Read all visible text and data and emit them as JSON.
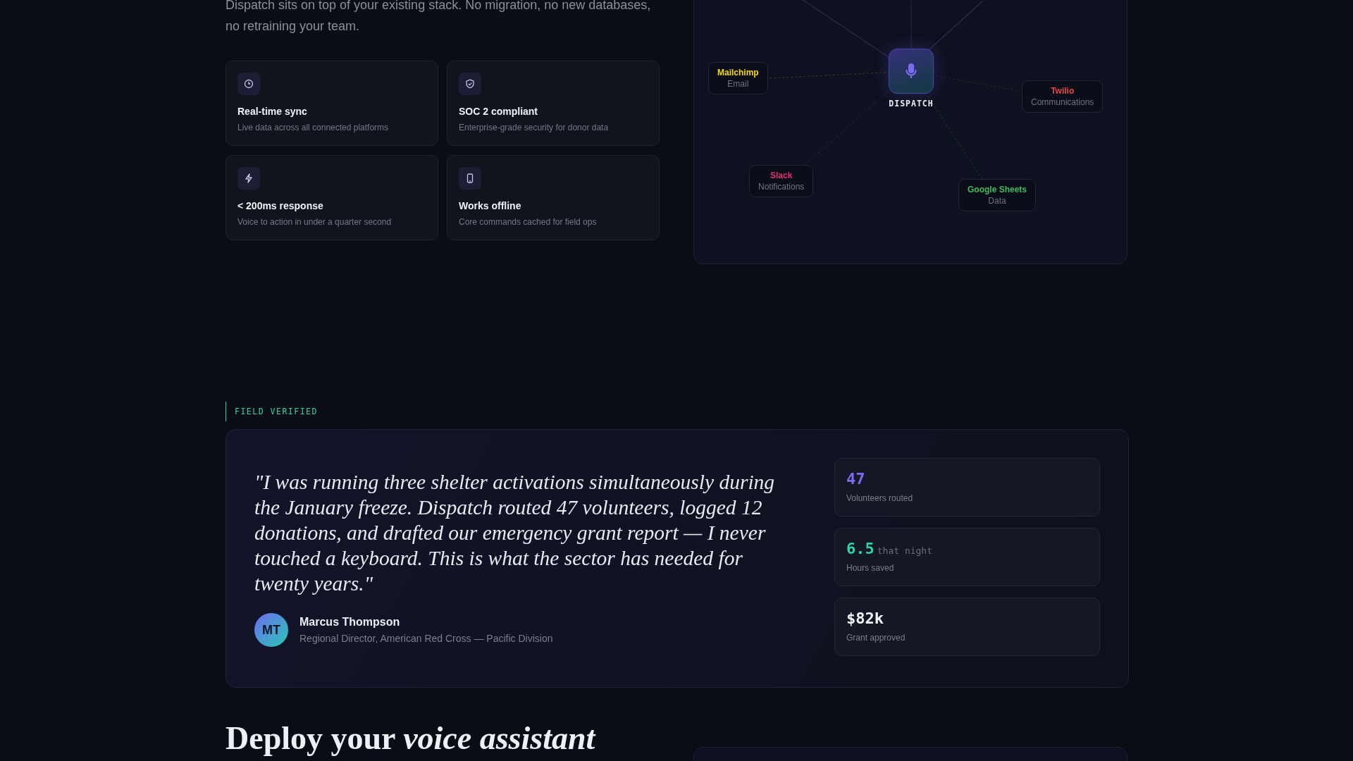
{
  "intro": {
    "text": "Dispatch sits on top of your existing stack. No migration, no new databases, no retraining your team."
  },
  "features": [
    {
      "title": "Real-time sync",
      "description": "Live data across all connected platforms"
    },
    {
      "title": "SOC 2 compliant",
      "description": "Enterprise-grade security for donor data"
    },
    {
      "title": "< 200ms response",
      "description": "Voice to action in under a quarter second"
    },
    {
      "title": "Works offline",
      "description": "Core commands cached for field ops"
    }
  ],
  "diagram": {
    "hub": "DISPATCH",
    "nodes": [
      {
        "name": "Mailchimp",
        "role": "Email",
        "color": "#f5d90a"
      },
      {
        "name": "Twilio",
        "role": "Communications",
        "color": "#e5484d"
      },
      {
        "name": "Slack",
        "role": "Notifications",
        "color": "#e0336e"
      },
      {
        "name": "Google Sheets",
        "role": "Data",
        "color": "#3fb95b"
      }
    ]
  },
  "testimonial": {
    "eyebrow": "FIELD VERIFIED",
    "quote": "\"I was running three shelter activations simultaneously during the January freeze. Dispatch routed 47 volunteers, logged 12 donations, and drafted our emergency grant report — I never touched a keyboard. This is what the sector has needed for twenty years.\"",
    "author": {
      "initials": "MT",
      "name": "Marcus Thompson",
      "role": "Regional Director, American Red Cross — Pacific Division"
    },
    "stats": [
      {
        "value": "47",
        "label": "Volunteers routed",
        "color": "#7c6cf2"
      },
      {
        "value": "6.5",
        "suffix": "that night",
        "label": "Hours saved",
        "color": "#2dd4a7"
      },
      {
        "value": "$82k",
        "label": "Grant approved",
        "color": "#f2f3f7"
      }
    ]
  },
  "next_section": {
    "heading": "Deploy your *voice assistant*"
  }
}
